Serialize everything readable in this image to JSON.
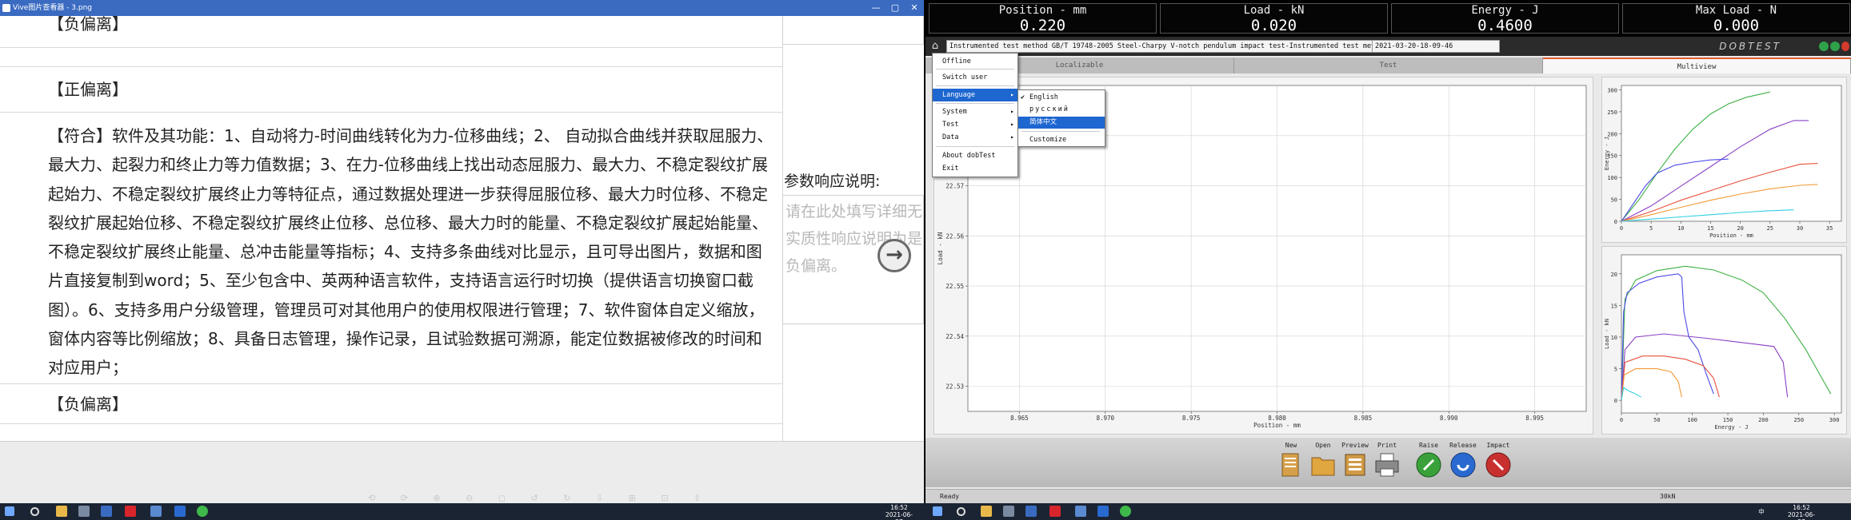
{
  "left_window": {
    "title": "Vive图片查看器 - 3.png",
    "win_min": "—",
    "win_max": "▢",
    "win_close": "✕",
    "row_top_header": "【负偏离】",
    "row_header_2": "【正偏离】",
    "paragraph": "【符合】软件及其功能：1、自动将力-时间曲线转化为力-位移曲线；2、 自动拟合曲线并获取屈服力、最大力、起裂力和终止力等力值数据；3、在力-位移曲线上找出动态屈服力、最大力、不稳定裂纹扩展起始力、不稳定裂纹扩展终止力等特征点，通过数据处理进一步获得屈服位移、最大力时位移、不稳定裂纹扩展起始位移、不稳定裂纹扩展终止位移、总位移、最大力时的能量、不稳定裂纹扩展起始能量、不稳定裂纹扩展终止能量、总冲击能量等指标；4、支持多条曲线对比显示，且可导出图片，数据和图片直接复制到word；5、至少包含中、英两种语言软件，支持语言运行时切换（提供语言切换窗口截图）。6、支持多用户分级管理，管理员可对其他用户的使用权限进行管理；7、软件窗体自定义缩放，窗体内容等比例缩放；8、具备日志管理，操作记录，且试验数据可溯源，能定位数据被修改的时间和对应用户；",
    "row_header_3": "【负偏离】",
    "side_label": "参数响应说明:",
    "side_placeholder": "请在此处填写详细无实质性响应说明为是负偏离。",
    "arrow": "→",
    "toolbar_glyphs": "⟲ ⟳ ⊕ ⊖ ◻ ↺ ↻ ⇩ ⊞ ⊡ ⇪"
  },
  "right_window": {
    "displays": [
      {
        "label": "Position - mm",
        "value": "0.220"
      },
      {
        "label": "Load - kN",
        "value": "0.020"
      },
      {
        "label": "Energy - J",
        "value": "0.4600"
      },
      {
        "label": "Max Load - N",
        "value": "0.000"
      }
    ],
    "method": "Instrumented test method GB/T 19748-2005 Steel-Charpy V-notch pendulum impact test-Instrumented test met ▾",
    "date": "2021-03-20-18-09-46",
    "brand": "DOBTEST",
    "tabs": [
      "Localizable",
      "Test",
      "Multiview"
    ],
    "menu": {
      "items": [
        "Offline",
        "Switch user",
        "Language",
        "System",
        "Test",
        "Data",
        "About dobTest",
        "Exit"
      ],
      "submenu": [
        "English",
        "русский",
        "简体中文",
        "Customize"
      ],
      "check": "✔",
      "arrow": "▸"
    },
    "toolbar": [
      {
        "label": "New",
        "icon": "new-document-icon"
      },
      {
        "label": "Open",
        "icon": "folder-icon"
      },
      {
        "label": "Preview",
        "icon": "preview-icon"
      },
      {
        "label": "Print",
        "icon": "printer-icon"
      },
      {
        "label": "Raise",
        "icon": "raise-icon"
      },
      {
        "label": "Release",
        "icon": "release-icon"
      },
      {
        "label": "Impact",
        "icon": "impact-icon"
      }
    ],
    "status": "Ready",
    "status_right": "30kN"
  },
  "taskbar": {
    "left_time": "16:52",
    "left_date": "2021-06-27",
    "right_time": "16:52",
    "right_date": "2021-06-27",
    "ime": "中"
  },
  "chart_data": [
    {
      "type": "line",
      "title": "",
      "xlabel": "Position - mm",
      "ylabel": "Load - kN",
      "xlim": [
        8.962,
        8.998
      ],
      "ylim": [
        22.525,
        22.59
      ],
      "x_ticks": [
        "8.965",
        "8.970",
        "8.975",
        "8.980",
        "8.985",
        "8.990",
        "8.995"
      ],
      "y_ticks": [
        "22.53",
        "22.54",
        "22.55",
        "22.56",
        "22.57",
        "22.58"
      ],
      "series": []
    },
    {
      "type": "line",
      "xlabel": "Position - mm",
      "ylabel": "Energy - J",
      "xlim": [
        0,
        37
      ],
      "ylim": [
        0,
        310
      ],
      "x_ticks": [
        "0",
        "5",
        "10",
        "15",
        "20",
        "25",
        "30",
        "35"
      ],
      "y_ticks": [
        "0",
        "50",
        "100",
        "150",
        "200",
        "250",
        "300"
      ],
      "series": [
        {
          "color": "#3cb043",
          "points": [
            [
              0,
              0
            ],
            [
              3,
              50
            ],
            [
              6,
              110
            ],
            [
              9,
              165
            ],
            [
              12,
              210
            ],
            [
              15,
              245
            ],
            [
              18,
              268
            ],
            [
              21,
              283
            ],
            [
              25,
              295
            ]
          ]
        },
        {
          "color": "#8a3fc4",
          "points": [
            [
              0,
              0
            ],
            [
              5,
              35
            ],
            [
              10,
              80
            ],
            [
              15,
              125
            ],
            [
              20,
              170
            ],
            [
              25,
              210
            ],
            [
              29,
              230
            ],
            [
              31.5,
              230
            ]
          ]
        },
        {
          "color": "#4a4ae8",
          "points": [
            [
              0,
              0
            ],
            [
              2,
              40
            ],
            [
              4,
              80
            ],
            [
              6,
              110
            ],
            [
              9,
              128
            ],
            [
              12,
              135
            ],
            [
              15,
              140
            ],
            [
              18,
              142
            ]
          ]
        },
        {
          "color": "#e8503c",
          "points": [
            [
              0,
              0
            ],
            [
              5,
              22
            ],
            [
              10,
              48
            ],
            [
              15,
              70
            ],
            [
              20,
              92
            ],
            [
              25,
              112
            ],
            [
              30,
              130
            ],
            [
              33,
              132
            ]
          ]
        },
        {
          "color": "#f39a36",
          "points": [
            [
              0,
              0
            ],
            [
              5,
              15
            ],
            [
              10,
              32
            ],
            [
              15,
              48
            ],
            [
              20,
              62
            ],
            [
              25,
              74
            ],
            [
              30,
              82
            ],
            [
              33,
              84
            ]
          ]
        },
        {
          "color": "#2fd0e0",
          "points": [
            [
              0,
              0
            ],
            [
              5,
              5
            ],
            [
              10,
              10
            ],
            [
              15,
              15
            ],
            [
              20,
              20
            ],
            [
              25,
              24
            ],
            [
              29,
              26
            ]
          ]
        }
      ]
    },
    {
      "type": "line",
      "xlabel": "Energy - J",
      "ylabel": "Load - kN",
      "xlim": [
        0,
        310
      ],
      "ylim": [
        -2,
        23
      ],
      "x_ticks": [
        "0",
        "50",
        "100",
        "150",
        "200",
        "250",
        "300"
      ],
      "y_ticks": [
        "0",
        "5",
        "10",
        "15",
        "20"
      ],
      "series": [
        {
          "color": "#3cb043",
          "points": [
            [
              0,
              0
            ],
            [
              5,
              16
            ],
            [
              20,
              19
            ],
            [
              50,
              20.5
            ],
            [
              90,
              21.2
            ],
            [
              130,
              20.6
            ],
            [
              170,
              19
            ],
            [
              200,
              17
            ],
            [
              230,
              13
            ],
            [
              260,
              8
            ],
            [
              285,
              3
            ],
            [
              295,
              1
            ]
          ]
        },
        {
          "color": "#4a4ae8",
          "points": [
            [
              0,
              0
            ],
            [
              3,
              14
            ],
            [
              8,
              17
            ],
            [
              25,
              18.5
            ],
            [
              50,
              19.5
            ],
            [
              80,
              20
            ],
            [
              85,
              19.5
            ],
            [
              88,
              14
            ],
            [
              95,
              10
            ],
            [
              108,
              8
            ],
            [
              120,
              4
            ],
            [
              130,
              1
            ]
          ]
        },
        {
          "color": "#8a3fc4",
          "points": [
            [
              0,
              0
            ],
            [
              5,
              8
            ],
            [
              20,
              10
            ],
            [
              60,
              10.5
            ],
            [
              120,
              9.8
            ],
            [
              180,
              9
            ],
            [
              215,
              8.5
            ],
            [
              228,
              6
            ],
            [
              234,
              0.5
            ]
          ]
        },
        {
          "color": "#e8503c",
          "points": [
            [
              0,
              0
            ],
            [
              5,
              6
            ],
            [
              30,
              7
            ],
            [
              60,
              7
            ],
            [
              90,
              6.5
            ],
            [
              115,
              5.5
            ],
            [
              130,
              3.5
            ],
            [
              138,
              0.5
            ]
          ]
        },
        {
          "color": "#f39a36",
          "points": [
            [
              0,
              0
            ],
            [
              4,
              4
            ],
            [
              20,
              5
            ],
            [
              50,
              5
            ],
            [
              70,
              4.5
            ],
            [
              80,
              3
            ],
            [
              85,
              0.5
            ]
          ]
        },
        {
          "color": "#2fd0e0",
          "points": [
            [
              0,
              0
            ],
            [
              3,
              2
            ],
            [
              10,
              1.5
            ],
            [
              20,
              1
            ],
            [
              28,
              0.5
            ]
          ]
        }
      ]
    }
  ]
}
